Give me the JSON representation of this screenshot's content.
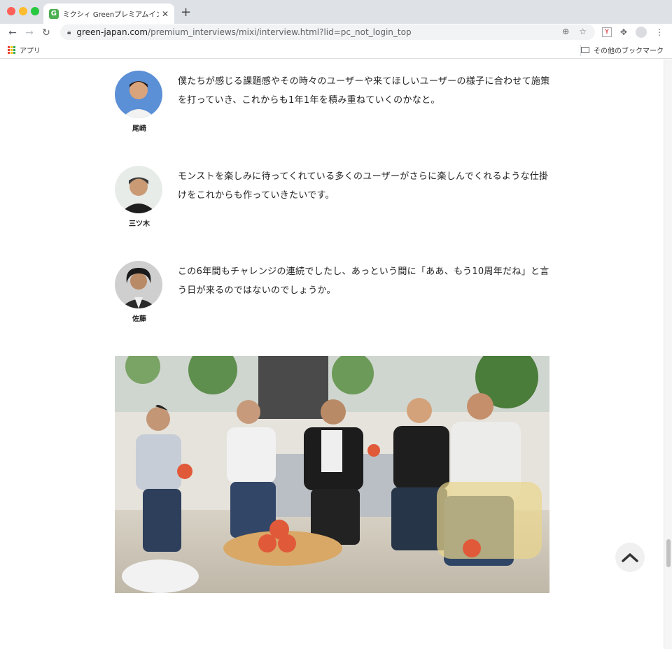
{
  "browser": {
    "tab_title": "ミクシィ Greenプレミアムインタ",
    "tab_favicon": "G",
    "tab_close": "✕",
    "new_tab": "+",
    "url_host": "green-japan.com",
    "url_path": "/premium_interviews/mixi/interview.html?lid=pc_not_login_top",
    "bookmarks_apps": "アプリ",
    "bookmarks_other": "その他のブックマーク",
    "ext_label": "Y"
  },
  "quotes": [
    {
      "speaker": "尾崎",
      "text": "僕たちが感じる課題感やその時々のユーザーや来てほしいユーザーの様子に合わせて施策を打っていき、これからも1年1年を積み重ねていくのかなと。"
    },
    {
      "speaker": "三ツ木",
      "text": "モンストを楽しみに待ってくれている多くのユーザーがさらに楽しんでくれるような仕掛けをこれからも作っていきたいです。"
    },
    {
      "speaker": "佐藤",
      "text": "この6年間もチャレンジの連続でしたし、あっという間に「ああ、もう10周年だね」と言う日が来るのではないのでしょうか。"
    }
  ],
  "icons": {
    "back": "back-arrow-icon",
    "forward": "forward-arrow-icon",
    "reload": "reload-icon",
    "lock": "lock-icon",
    "zoom": "zoom-icon",
    "star": "star-icon",
    "extensions": "puzzle-icon",
    "menu": "kebab-menu-icon",
    "scroll_top": "chevron-up-icon"
  },
  "colors": {
    "tab_bar": "#dee1e6",
    "favicon": "#4caf50",
    "text": "#222222"
  }
}
